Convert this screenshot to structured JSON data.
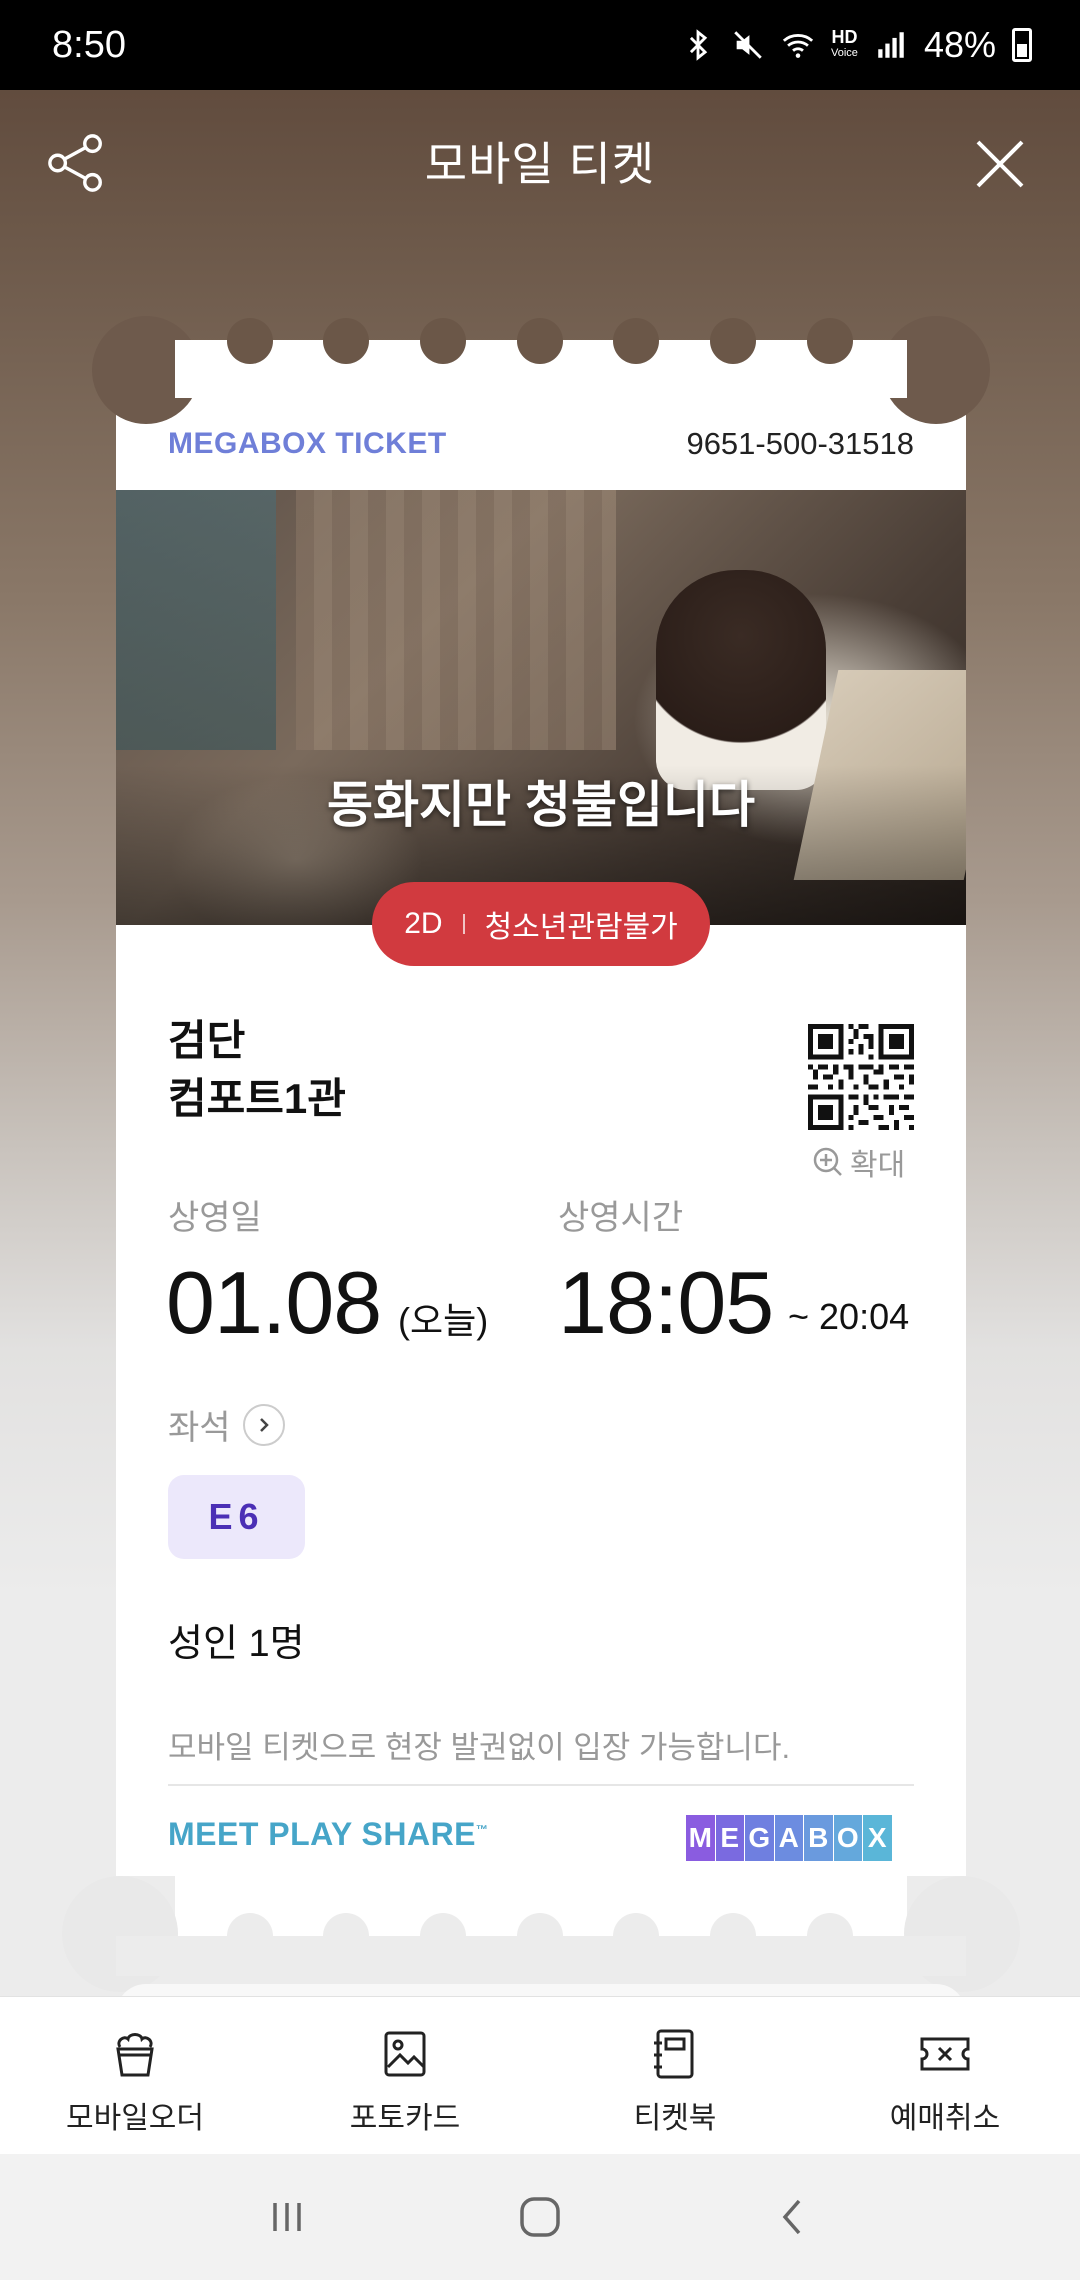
{
  "status_bar": {
    "time": "8:50",
    "hd_label": "HD",
    "voice_label": "Voice",
    "battery": "48%"
  },
  "header": {
    "title": "모바일 티켓"
  },
  "ticket": {
    "brand": "MEGABOX TICKET",
    "number": "9651-500-31518",
    "movie_title": "동화지만 청불입니다",
    "format": "2D",
    "rating": "청소년관람불가",
    "theater": "검단",
    "screen": "컴포트1관",
    "zoom_label": "확대",
    "date_label": "상영일",
    "date": "01.08",
    "date_note": "(오늘)",
    "time_label": "상영시간",
    "start_time": "18:05",
    "end_time": "~ 20:04",
    "seat_label": "좌석",
    "seat": "E6",
    "people": "성인 1명",
    "notice": "모바일 티켓으로 현장 발권없이 입장 가능합니다.",
    "slogan": "MEET PLAY SHARE",
    "slogan_tm": "™",
    "logo_letters": [
      "M",
      "E",
      "G",
      "A",
      "B",
      "O",
      "X"
    ]
  },
  "actions": [
    {
      "label": "모바일오더",
      "icon": "popcorn-icon"
    },
    {
      "label": "포토카드",
      "icon": "photo-card-icon"
    },
    {
      "label": "티켓북",
      "icon": "ticket-book-icon"
    },
    {
      "label": "예매취소",
      "icon": "cancel-ticket-icon"
    }
  ],
  "colors": {
    "brand_purple": "#6f7fd8",
    "rating_red": "#d13a3f",
    "seat_bg": "#ece8fb",
    "seat_text": "#4b2fb5",
    "slogan_blue": "#46a5c8",
    "logo_gradient": [
      "#8a5ce0",
      "#7a6ae0",
      "#6f7fe0",
      "#6c8ce0",
      "#6a9ade",
      "#64a8dc",
      "#5ab6d8"
    ]
  }
}
